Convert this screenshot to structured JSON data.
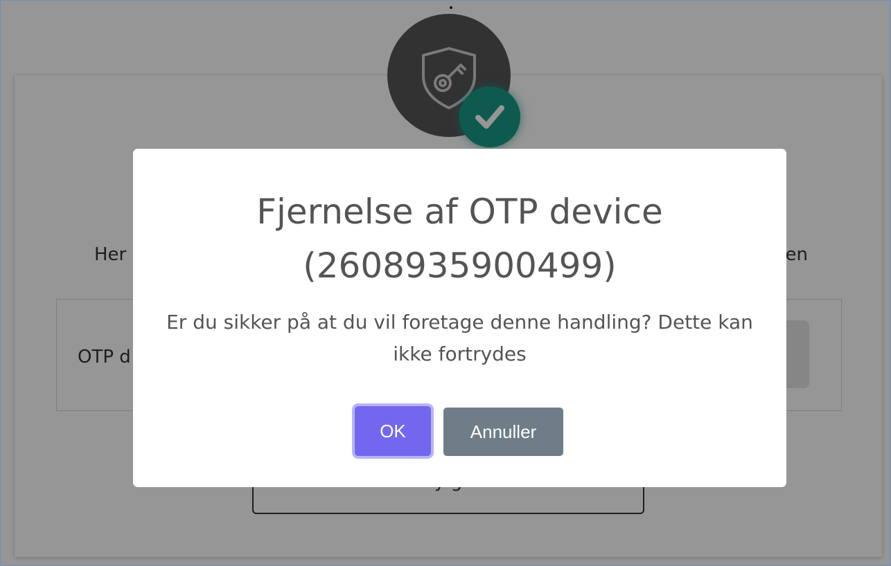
{
  "background": {
    "intro_start": "Her",
    "intro_end": "en",
    "otp_label": "OTP d",
    "bottom_button_text": "y   g"
  },
  "icons": {
    "hero": "shield-key-icon",
    "badge": "checkmark-icon"
  },
  "dialog": {
    "title": "Fjernelse af OTP device (2608935900499)",
    "message": "Er du sikker på at du vil foretage denne handling? Dette kan ikke fortrydes",
    "confirm_label": "OK",
    "cancel_label": "Annuller"
  },
  "colors": {
    "confirm": "#7367f0",
    "cancel": "#6e7d88",
    "success_badge": "#1b9a86",
    "overlay": "rgba(0,0,0,0.41)"
  }
}
